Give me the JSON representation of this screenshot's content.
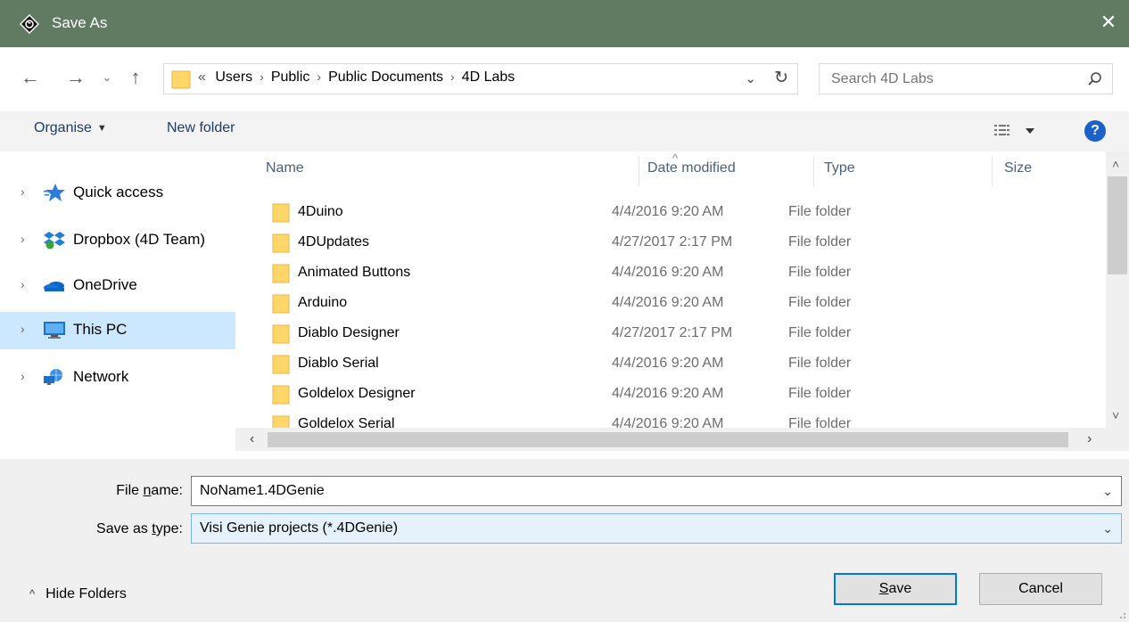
{
  "window": {
    "title": "Save As",
    "close_glyph": "✕",
    "title_bar_color": "#607b61"
  },
  "address": {
    "overflow_glyph": "«",
    "breadcrumbs": [
      "Users",
      "Public",
      "Public Documents",
      "4D Labs"
    ],
    "search_placeholder": "Search 4D Labs"
  },
  "toolbar": {
    "organise_label": "Organise",
    "new_folder_label": "New folder",
    "help_label": "?"
  },
  "nav": {
    "items": [
      {
        "label": "Quick access",
        "icon": "star-icon"
      },
      {
        "label": "Dropbox (4D Team)",
        "icon": "dropbox-icon"
      },
      {
        "label": "OneDrive",
        "icon": "onedrive-icon"
      },
      {
        "label": "This PC",
        "icon": "computer-icon",
        "selected": true
      },
      {
        "label": "Network",
        "icon": "network-icon"
      }
    ]
  },
  "files": {
    "columns": {
      "name": "Name",
      "date": "Date modified",
      "type": "Type",
      "size": "Size"
    },
    "rows": [
      {
        "name": "4Duino",
        "date": "4/4/2016 9:20 AM",
        "type": "File folder"
      },
      {
        "name": "4DUpdates",
        "date": "4/27/2017 2:17 PM",
        "type": "File folder"
      },
      {
        "name": "Animated Buttons",
        "date": "4/4/2016 9:20 AM",
        "type": "File folder"
      },
      {
        "name": "Arduino",
        "date": "4/4/2016 9:20 AM",
        "type": "File folder"
      },
      {
        "name": "Diablo Designer",
        "date": "4/27/2017 2:17 PM",
        "type": "File folder"
      },
      {
        "name": "Diablo Serial",
        "date": "4/4/2016 9:20 AM",
        "type": "File folder"
      },
      {
        "name": "Goldelox Designer",
        "date": "4/4/2016 9:20 AM",
        "type": "File folder"
      },
      {
        "name": "Goldelox Serial",
        "date": "4/4/2016 9:20 AM",
        "type": "File folder"
      }
    ]
  },
  "form": {
    "file_name_label_pre": "File ",
    "file_name_label_key": "n",
    "file_name_label_post": "ame:",
    "file_name_value": "NoName1.4DGenie",
    "save_type_label_pre": "Save as ",
    "save_type_label_key": "t",
    "save_type_label_post": "ype:",
    "save_type_value": "Visi Genie projects (*.4DGenie)"
  },
  "footer": {
    "hide_folders_label": "Hide Folders",
    "save_key": "S",
    "save_rest": "ave",
    "cancel_label": "Cancel"
  }
}
